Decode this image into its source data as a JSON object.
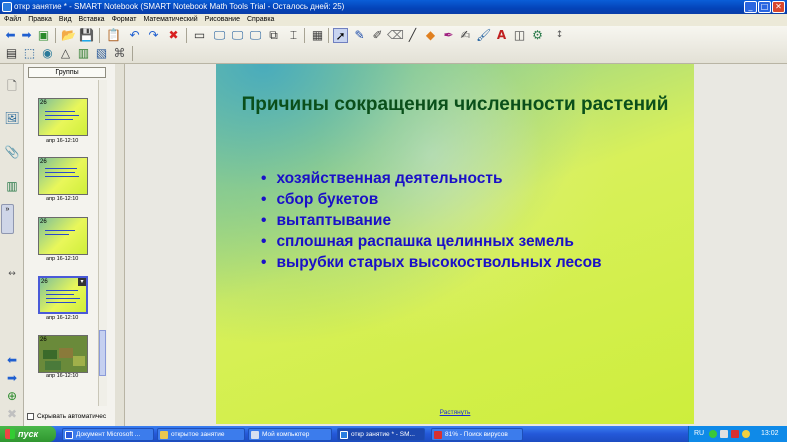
{
  "window": {
    "title": "откр занятие * - SMART Notebook (SMART Notebook Math Tools Trial - Осталось дней: 25)",
    "minimize": "_",
    "maximize": "□",
    "close": "✕"
  },
  "menu": [
    "Файл",
    "Правка",
    "Вид",
    "Вставка",
    "Формат",
    "Математический",
    "Рисование",
    "Справка"
  ],
  "sorter": {
    "groups_label": "Группы",
    "thumb_labels": [
      "апр 16-12:10",
      "апр 16-12:10",
      "апр 16-12:10",
      "апр 16-12:10",
      "апр 16-12:10"
    ],
    "thumb_nums": [
      "26",
      "26",
      "26",
      "26",
      "26"
    ],
    "autohide_label": "Скрывать автоматичес"
  },
  "slide": {
    "title": "Причины сокращения численности растений",
    "bullets": [
      "хозяйственная деятельность",
      "сбор букетов",
      "вытаптывание",
      "сплошная распашка  целинных земель",
      "вырубки старых высокоствольных лесов"
    ],
    "stretch_link": "Растянуть",
    "colors": {
      "title": "#0a4f1a",
      "bullets": "#1a10c8"
    }
  },
  "taskbar": {
    "start_label": "пуск",
    "tasks": [
      "Документ Microsoft ...",
      "открытое занятие",
      "Мой компьютер",
      "откр занятие * - SM...",
      "81% - Поиск вирусов"
    ],
    "language": "RU",
    "clock": "13:02"
  }
}
